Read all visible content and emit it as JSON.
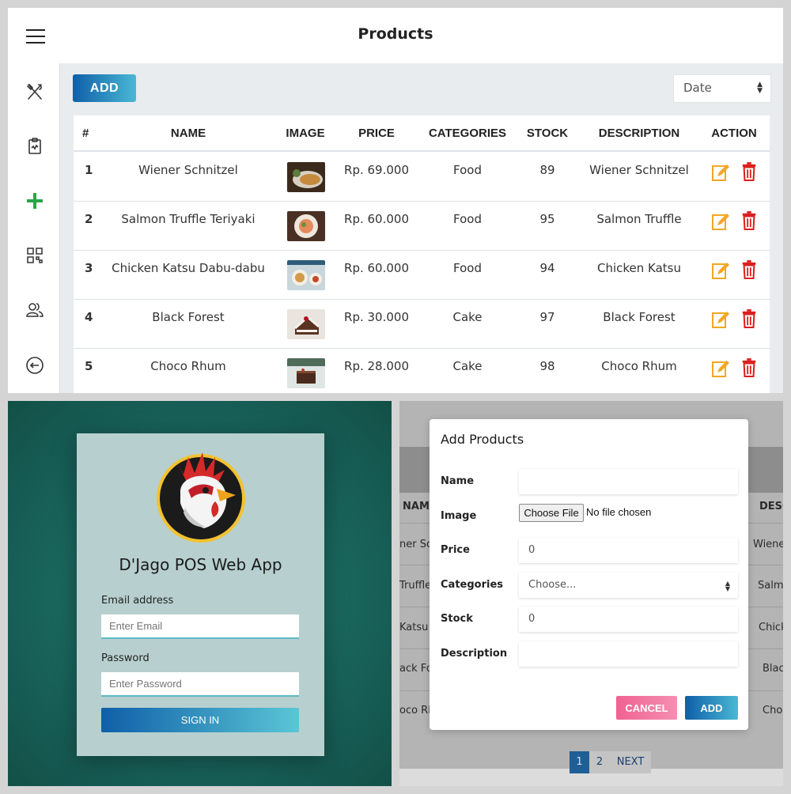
{
  "products_page": {
    "title": "Products",
    "add_label": "ADD",
    "sort_value": "Date",
    "headers": [
      "#",
      "NAME",
      "IMAGE",
      "PRICE",
      "CATEGORIES",
      "STOCK",
      "DESCRIPTION",
      "ACTION"
    ],
    "rows": [
      {
        "num": "1",
        "name": "Wiener Schnitzel",
        "price": "Rp. 69.000",
        "category": "Food",
        "stock": "89",
        "description": "Wiener Schnitzel"
      },
      {
        "num": "2",
        "name": "Salmon Truffle Teriyaki",
        "price": "Rp. 60.000",
        "category": "Food",
        "stock": "95",
        "description": "Salmon Truffle"
      },
      {
        "num": "3",
        "name": "Chicken Katsu Dabu-dabu",
        "price": "Rp. 60.000",
        "category": "Food",
        "stock": "94",
        "description": "Chicken Katsu"
      },
      {
        "num": "4",
        "name": "Black Forest",
        "price": "Rp. 30.000",
        "category": "Cake",
        "stock": "97",
        "description": "Black Forest"
      },
      {
        "num": "5",
        "name": "Choco Rhum",
        "price": "Rp. 28.000",
        "category": "Cake",
        "stock": "98",
        "description": "Choco Rhum"
      }
    ],
    "sidebar_icons": [
      "utensils-icon",
      "clipboard-icon",
      "plus-icon",
      "grid-icon",
      "users-icon",
      "logout-icon"
    ]
  },
  "login": {
    "app_title": "D'Jago POS Web App",
    "email_label": "Email address",
    "email_placeholder": "Enter Email",
    "password_label": "Password",
    "password_placeholder": "Enter Password",
    "signin_label": "SIGN IN"
  },
  "modal": {
    "title": "Add Products",
    "name_label": "Name",
    "image_label": "Image",
    "choose_file": "Choose File",
    "no_file": "No file chosen",
    "price_label": "Price",
    "price_value": "0",
    "categories_label": "Categories",
    "categories_value": "Choose...",
    "stock_label": "Stock",
    "stock_value": "0",
    "description_label": "Description",
    "cancel_label": "CANCEL",
    "add_label": "ADD",
    "background": {
      "name_header": "NAME",
      "desc_header": "DESC",
      "name_cells": [
        "ner Sch",
        "Truffle",
        "Katsu D",
        "ack For",
        "oco Rh"
      ],
      "desc_cells": [
        "Wiene",
        "Salm",
        "Chick",
        "Blac",
        "Cho"
      ]
    },
    "pagination": [
      "1",
      "2",
      "NEXT"
    ]
  },
  "colors": {
    "primary_gradient_start": "#0f5fa8",
    "primary_gradient_end": "#4ab8d4",
    "plus_green": "#28a745",
    "edit_orange": "#f5a623",
    "delete_red": "#dc1e1e",
    "cancel_pink": "#f06292",
    "login_bg": "#18625a"
  }
}
